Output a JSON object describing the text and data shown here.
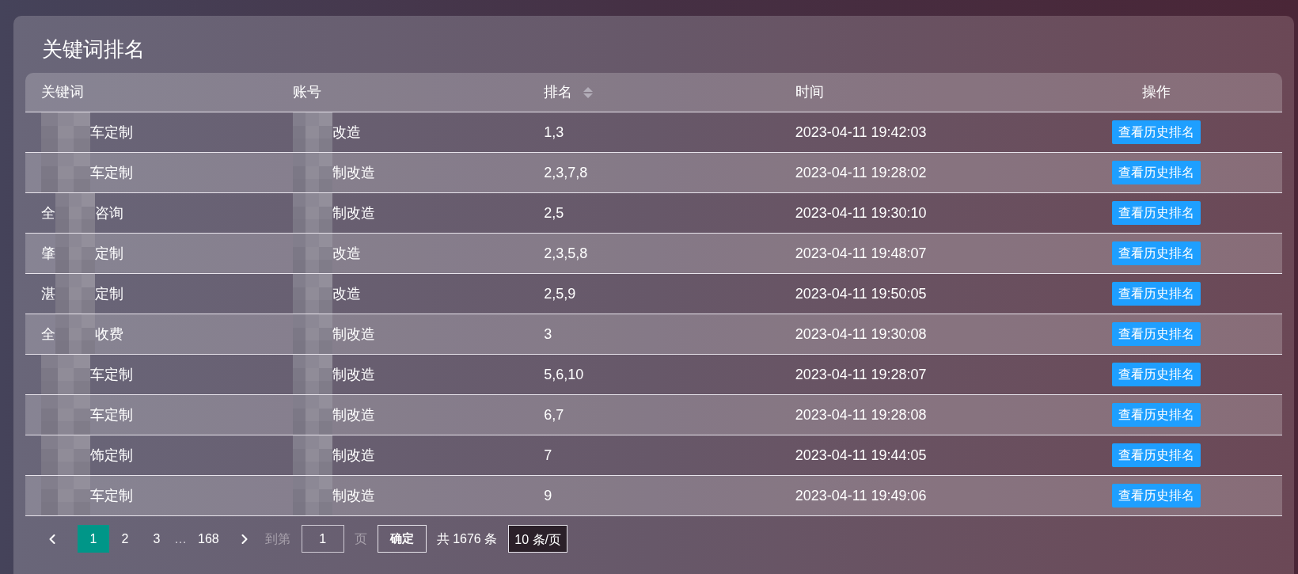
{
  "page": {
    "title": "关键词排名"
  },
  "table": {
    "columns": [
      {
        "label": "关键词"
      },
      {
        "label": "账号"
      },
      {
        "label": "排名",
        "sortable": true
      },
      {
        "label": "时间"
      },
      {
        "label": "操作"
      }
    ],
    "rows": [
      {
        "keyword": {
          "end": "车定制"
        },
        "account": {
          "end": "改造"
        },
        "rank": "1,3",
        "time": "2023-04-11 19:42:03",
        "action": "查看历史排名"
      },
      {
        "keyword": {
          "end": "车定制"
        },
        "account": {
          "end": "制改造"
        },
        "rank": "2,3,7,8",
        "time": "2023-04-11 19:28:02",
        "action": "查看历史排名"
      },
      {
        "keyword": {
          "start": "全",
          "end": "咨询"
        },
        "account": {
          "end": "制改造"
        },
        "rank": "2,5",
        "time": "2023-04-11 19:30:10",
        "action": "查看历史排名"
      },
      {
        "keyword": {
          "start": "肇",
          "end": "定制"
        },
        "account": {
          "end": "改造"
        },
        "rank": "2,3,5,8",
        "time": "2023-04-11 19:48:07",
        "action": "查看历史排名"
      },
      {
        "keyword": {
          "start": "湛",
          "end": "定制"
        },
        "account": {
          "end": "改造"
        },
        "rank": "2,5,9",
        "time": "2023-04-11 19:50:05",
        "action": "查看历史排名"
      },
      {
        "keyword": {
          "start": "全",
          "end": "收费"
        },
        "account": {
          "end": "制改造"
        },
        "rank": "3",
        "time": "2023-04-11 19:30:08",
        "action": "查看历史排名"
      },
      {
        "keyword": {
          "end": "车定制"
        },
        "account": {
          "end": "制改造"
        },
        "rank": "5,6,10",
        "time": "2023-04-11 19:28:07",
        "action": "查看历史排名"
      },
      {
        "keyword": {
          "end": "车定制"
        },
        "account": {
          "end": "制改造"
        },
        "rank": "6,7",
        "time": "2023-04-11 19:28:08",
        "action": "查看历史排名"
      },
      {
        "keyword": {
          "end": "饰定制"
        },
        "account": {
          "end": "制改造"
        },
        "rank": "7",
        "time": "2023-04-11 19:44:05",
        "action": "查看历史排名"
      },
      {
        "keyword": {
          "end": "车定制"
        },
        "account": {
          "end": "制改造"
        },
        "rank": "9",
        "time": "2023-04-11 19:49:06",
        "action": "查看历史排名"
      }
    ]
  },
  "pagination": {
    "pages": [
      {
        "kind": "page",
        "label": "1",
        "selected": true
      },
      {
        "kind": "page",
        "label": "2",
        "selected": false
      },
      {
        "kind": "page",
        "label": "3",
        "selected": false
      },
      {
        "kind": "ellipsis",
        "label": "…"
      },
      {
        "kind": "page",
        "label": "168",
        "selected": false
      }
    ],
    "goto": {
      "label": "到第",
      "value": "1",
      "unit": "页"
    },
    "confirm": "确定",
    "total": "共 1676 条",
    "page_size": "10 条/页"
  }
}
